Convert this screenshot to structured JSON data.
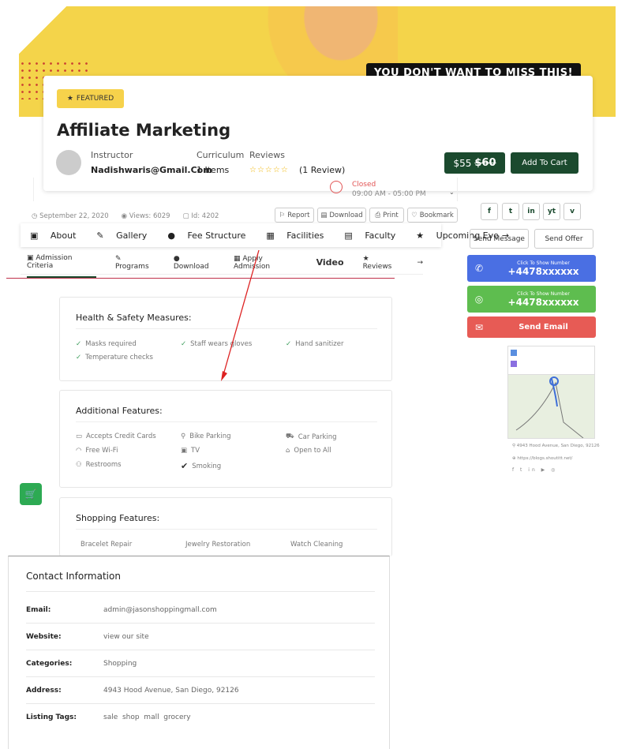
{
  "hero": {
    "banner": "YOU DON'T WANT TO MISS THIS!"
  },
  "listing": {
    "badge": "FEATURED",
    "title": "Affiliate Marketing",
    "instructor_label": "Instructor",
    "instructor_value": "Nadishwaris@Gmail.Com",
    "curriculum_label": "Curriculum",
    "curriculum_value": "1 Items",
    "reviews_label": "Reviews",
    "reviews_stars": "☆☆☆☆☆",
    "reviews_value": "(1 Review)",
    "price_new": "$55",
    "price_old": "$60",
    "add_to_cart": "Add To Cart",
    "status": "Closed",
    "hours": "09:00 AM - 05:00 PM"
  },
  "meta": {
    "date": "September 22, 2020",
    "views": "Views: 6029",
    "id": "Id: 4202"
  },
  "actions": {
    "report": "Report",
    "download": "Download",
    "print": "Print",
    "bookmark": "Bookmark"
  },
  "tabs1": [
    "About",
    "Gallery",
    "Fee Structure",
    "Facilities",
    "Faculty",
    "Upcoming Eve"
  ],
  "tabs2": [
    "Admission Criteria",
    "Programs",
    "Download",
    "Apply Admission",
    "Video",
    "Reviews"
  ],
  "health": {
    "title": "Health & Safety Measures:",
    "items": [
      "Masks required",
      "Staff wears gloves",
      "Hand sanitizer",
      "Temperature checks"
    ]
  },
  "additional": {
    "title": "Additional Features:",
    "items": [
      "Accepts Credit Cards",
      "Bike Parking",
      "Car Parking",
      "Free Wi-Fi",
      "TV",
      "Open to All",
      "Restrooms",
      "Smoking"
    ]
  },
  "shopping": {
    "title": "Shopping Features:",
    "items": [
      "Bracelet Repair",
      "Jewelry Restoration",
      "Watch Cleaning"
    ]
  },
  "social": [
    "f",
    "t",
    "in",
    "yt",
    "v"
  ],
  "side": {
    "send_message": "Send Message",
    "send_offer": "Send Offer",
    "call_hint": "Click To Show Number",
    "call_number": "+4478xxxxxx",
    "wa_hint": "Click To Show Number",
    "wa_number": "+4478xxxxxx",
    "email": "Send Email",
    "map_address": "4943 Hood Avenue, San Diego, 92126",
    "map_url": "https://blogs.shoutitt.net/",
    "colors": {
      "call": "#4a6fe3",
      "whatsapp": "#5ebd4f",
      "email": "#e75b55"
    }
  },
  "contact": {
    "title": "Contact Information",
    "rows": [
      {
        "label": "Email:",
        "value": "admin@jasonshoppingmall.com"
      },
      {
        "label": "Website:",
        "value": "view our site"
      },
      {
        "label": "Categories:",
        "value": "Shopping"
      },
      {
        "label": "Address:",
        "value": "4943 Hood Avenue, San Diego, 92126"
      },
      {
        "label": "Listing Tags:",
        "value": "sale  shop  mall  grocery"
      }
    ]
  }
}
